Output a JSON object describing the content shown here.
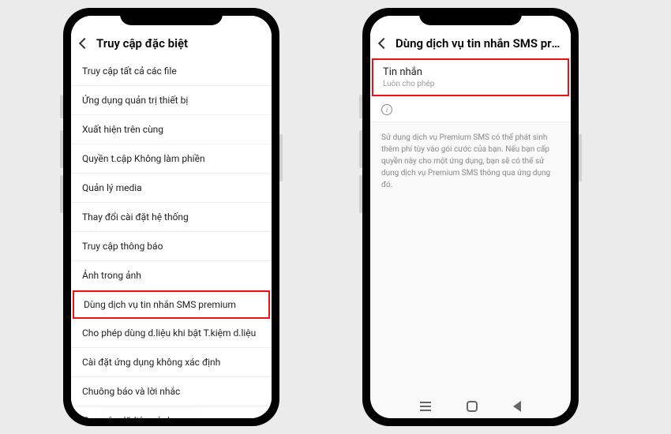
{
  "left": {
    "header": {
      "title": "Truy cập đặc biệt"
    },
    "items": [
      "Truy cập tất cả các file",
      "Ứng dụng quản trị thiết bị",
      "Xuất hiện trên cùng",
      "Quyền t.cập Không làm phiền",
      "Quản lý media",
      "Thay đổi cài đặt hệ thống",
      "Truy cập thông báo",
      "Ảnh trong ảnh",
      "Dùng dịch vụ tin nhắn SMS premium",
      "Cho phép dùng d.liệu khi bật T.kiệm d.liệu",
      "Cài đặt ứng dụng không xác định",
      "Chuông báo và lời nhắc",
      "Truy cập dữ liệu sử dụng"
    ],
    "highlight_index": 8
  },
  "right": {
    "header": {
      "title": "Dùng dịch vụ tin nhắn SMS pre…"
    },
    "section": {
      "title": "Tin nhắn",
      "subtitle": "Luôn cho phép"
    },
    "info_glyph": "i",
    "description": "Sử dụng dịch vụ Premium SMS có thể phát sinh thêm phí tùy vào gói cước của bạn. Nếu bạn cấp quyền này cho một ứng dụng, bạn sẽ có thể sử dụng dịch vụ Premium SMS thông qua ứng dụng đó."
  }
}
